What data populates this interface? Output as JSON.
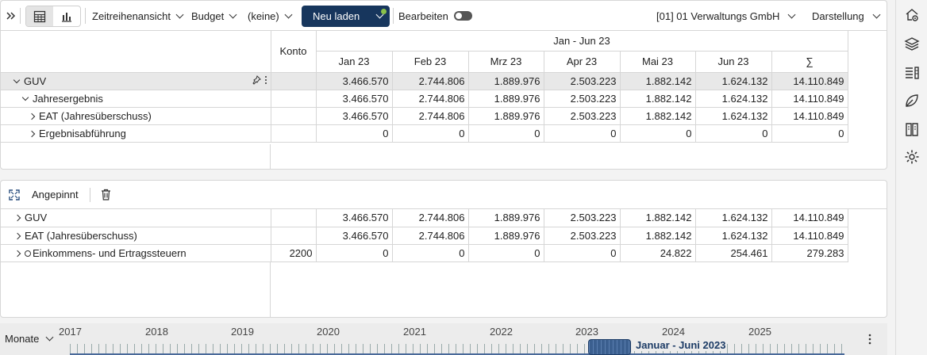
{
  "toolbar": {
    "view_mode": "Zeitreihenansicht",
    "scenario": "Budget",
    "filter": "(keine)",
    "reload_label": "Neu laden",
    "edit_label": "Bearbeiten",
    "company": "[01] 01 Verwaltungs GmbH",
    "display_label": "Darstellung",
    "icons": [
      "expand-panel-icon",
      "table-view-icon",
      "chart-view-icon"
    ]
  },
  "main_table": {
    "konto_header": "Konto",
    "period_header": "Jan - Jun 23",
    "columns": [
      "Jan 23",
      "Feb 23",
      "Mrz 23",
      "Apr 23",
      "Mai 23",
      "Jun 23",
      "∑"
    ],
    "rows": [
      {
        "label": "GUV",
        "konto": "",
        "values": [
          "3.466.570",
          "2.744.806",
          "1.889.976",
          "2.503.223",
          "1.882.142",
          "1.624.132",
          "14.110.849"
        ]
      },
      {
        "label": "Jahresergebnis",
        "konto": "",
        "values": [
          "3.466.570",
          "2.744.806",
          "1.889.976",
          "2.503.223",
          "1.882.142",
          "1.624.132",
          "14.110.849"
        ]
      },
      {
        "label": "EAT (Jahresüberschuss)",
        "konto": "",
        "values": [
          "3.466.570",
          "2.744.806",
          "1.889.976",
          "2.503.223",
          "1.882.142",
          "1.624.132",
          "14.110.849"
        ]
      },
      {
        "label": "Ergebnisabführung",
        "konto": "",
        "values": [
          "0",
          "0",
          "0",
          "0",
          "0",
          "0",
          "0"
        ]
      }
    ]
  },
  "pinned": {
    "title": "Angepinnt",
    "rows": [
      {
        "label": "GUV",
        "konto": "",
        "values": [
          "3.466.570",
          "2.744.806",
          "1.889.976",
          "2.503.223",
          "1.882.142",
          "1.624.132",
          "14.110.849"
        ]
      },
      {
        "label": "EAT (Jahresüberschuss)",
        "konto": "",
        "values": [
          "3.466.570",
          "2.744.806",
          "1.889.976",
          "2.503.223",
          "1.882.142",
          "1.624.132",
          "14.110.849"
        ]
      },
      {
        "label": "Einkommens- und Ertragssteuern",
        "konto": "2200",
        "values": [
          "0",
          "0",
          "0",
          "0",
          "24.822",
          "254.461",
          "279.283"
        ]
      }
    ]
  },
  "timeline": {
    "granularity": "Monate",
    "years": [
      "2017",
      "2018",
      "2019",
      "2020",
      "2021",
      "2022",
      "2023",
      "2024",
      "2025"
    ],
    "selection_label": "Januar - Juni 2023"
  },
  "sidebar": {
    "icons": [
      "home-settings-icon",
      "layers-icon",
      "report-list-icon",
      "leaf-icon",
      "book-icon",
      "gear-icon"
    ]
  },
  "colors": {
    "primary": "#17365d",
    "status_dot": "#8bc34a",
    "row_highlight": "#e8e8e8"
  }
}
